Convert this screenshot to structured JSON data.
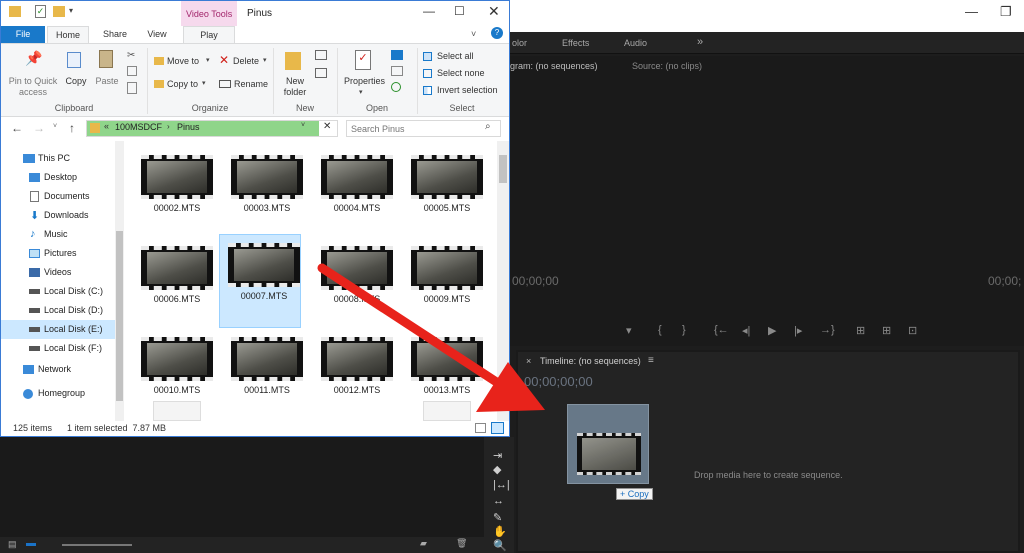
{
  "explorer": {
    "title": "Pinus",
    "context_tab": "Video Tools",
    "tabs": [
      "File",
      "Home",
      "Share",
      "View",
      "Play"
    ],
    "ribbon": {
      "clipboard": {
        "pin": "Pin to Quick access",
        "copy": "Copy",
        "paste": "Paste",
        "label": "Clipboard"
      },
      "organize": {
        "move_to": "Move to",
        "copy_to": "Copy to",
        "delete": "Delete",
        "rename": "Rename",
        "label": "Organize"
      },
      "new": {
        "new_folder": "New folder",
        "label": "New"
      },
      "open": {
        "properties": "Properties",
        "label": "Open"
      },
      "select": {
        "select_all": "Select all",
        "select_none": "Select none",
        "invert": "Invert selection",
        "label": "Select"
      }
    },
    "address": {
      "crumb_root": "100MSDCF",
      "crumb_current": "Pinus",
      "search_placeholder": "Search Pinus"
    },
    "nav": [
      "This PC",
      "Desktop",
      "Documents",
      "Downloads",
      "Music",
      "Pictures",
      "Videos",
      "Local Disk (C:)",
      "Local Disk (D:)",
      "Local Disk (E:)",
      "Local Disk (F:)",
      "Network",
      "Homegroup"
    ],
    "files": [
      "00002.MTS",
      "00003.MTS",
      "00004.MTS",
      "00005.MTS",
      "00006.MTS",
      "00007.MTS",
      "00008.MTS",
      "00009.MTS",
      "00010.MTS",
      "00011.MTS",
      "00012.MTS",
      "00013.MTS"
    ],
    "selected_file": "00007.MTS",
    "status": {
      "count": "125 items",
      "selection": "1 item selected  7.87 MB"
    }
  },
  "premiere": {
    "tabs": [
      "olor",
      "Effects",
      "Audio",
      "»"
    ],
    "program_title": "gram: (no sequences)",
    "source_title": "Source: (no clips)",
    "timecode_left": "00;00;00",
    "timecode_right": "00;00;",
    "timeline_title": "Timeline: (no sequences)",
    "timeline_timecode": "00;00;00;00",
    "drop_hint": "Drop media here to create sequence.",
    "copy_badge": "+ Copy"
  },
  "colors": {
    "arrow": "#e8231b",
    "accent": "#1a73c8",
    "selection": "#cce8ff"
  }
}
